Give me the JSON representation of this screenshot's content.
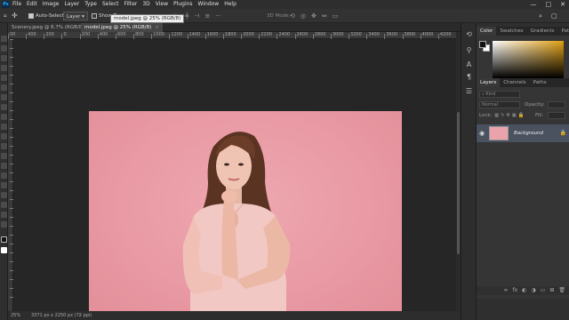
{
  "menubar": {
    "logo": "Ps",
    "menus": [
      "File",
      "Edit",
      "Image",
      "Layer",
      "Type",
      "Select",
      "Filter",
      "3D",
      "View",
      "Plugins",
      "Window",
      "Help"
    ],
    "window_controls": [
      "—",
      "□",
      "✕"
    ]
  },
  "options": {
    "auto_select_label": "Auto-Select:",
    "auto_select_value": "Layer",
    "show_transform_label": "Show T",
    "mode_3d_label": "3D Mode:",
    "tooltip": "model.jpeg @ 25% (RGB/8)"
  },
  "tabs": [
    {
      "label": "Scenery.jpeg @ 6.7% (RGB/8#)",
      "active": false
    },
    {
      "label": "model.jpeg @ 25% (RGB/8)",
      "active": true
    }
  ],
  "ruler": {
    "top_labels": [
      "00",
      "400",
      "200",
      "0",
      "200",
      "400",
      "600",
      "800",
      "1000",
      "1200",
      "1400",
      "1600",
      "1800",
      "2000",
      "2200",
      "2400",
      "2600",
      "2800",
      "3000",
      "3200",
      "3400",
      "3600",
      "3800",
      "4000",
      "4200"
    ]
  },
  "status": {
    "zoom": "25%",
    "doc_info": "3371 px x 2250 px (72 ppi)"
  },
  "panels": {
    "color_tabs": [
      "Color",
      "Swatches",
      "Gradients",
      "Patterns"
    ],
    "layers_tabs": [
      "Layers",
      "Channels",
      "Paths"
    ],
    "kind_label": "Kind",
    "blend_mode": "Normal",
    "opacity_label": "Opacity:",
    "lock_label": "Lock:",
    "fill_label": "Fill:",
    "layer_name": "Background"
  },
  "colors": {
    "foreground": "#111111",
    "background": "#ffffff",
    "photo_pink": "#e99aa4"
  }
}
